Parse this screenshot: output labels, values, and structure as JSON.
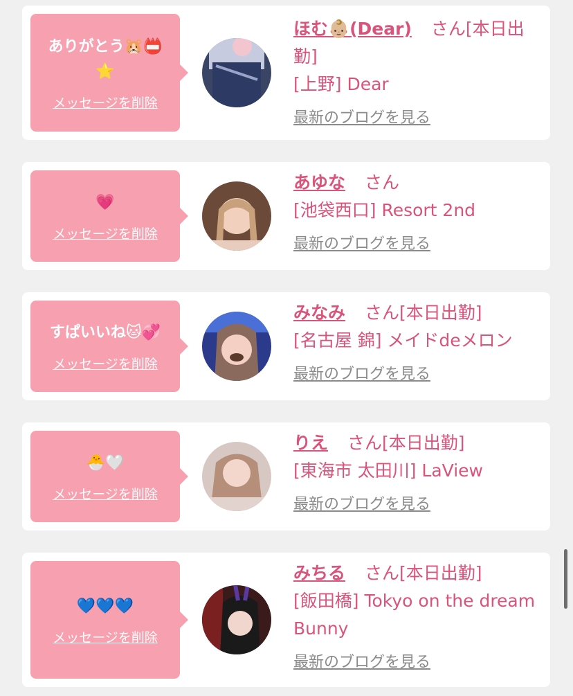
{
  "cards": [
    {
      "message": "ありがとう🐹📛\n⭐",
      "delete_label": "メッセージを削除",
      "name": "ほむ👶🏼(Dear)",
      "suffix": "さん[本日出勤]",
      "shop": "[上野] Dear",
      "blog_link": "最新のブログを見る"
    },
    {
      "message": "💗",
      "delete_label": "メッセージを削除",
      "name": "あゆな",
      "suffix": "さん",
      "shop": "[池袋西口] Resort 2nd",
      "blog_link": "最新のブログを見る"
    },
    {
      "message": "すぱいいね🐱💞",
      "delete_label": "メッセージを削除",
      "name": "みなみ",
      "suffix": "さん[本日出勤]",
      "shop": "[名古屋 錦] メイドdeメロン",
      "blog_link": "最新のブログを見る"
    },
    {
      "message": "🐣🤍",
      "delete_label": "メッセージを削除",
      "name": "りえ",
      "suffix": "さん[本日出勤]",
      "shop": "[東海市 太田川] LaView",
      "blog_link": "最新のブログを見る"
    },
    {
      "message": "💙💙💙",
      "delete_label": "メッセージを削除",
      "name": "みちる",
      "suffix": "さん[本日出勤]",
      "shop": "[飯田橋] Tokyo on the dream Bunny",
      "blog_link": "最新のブログを見る"
    }
  ],
  "colors": {
    "bubble": "#f7a1b0",
    "accent": "#d9547a",
    "link_gray": "#8b8b8b",
    "background": "#f0f0f0"
  }
}
